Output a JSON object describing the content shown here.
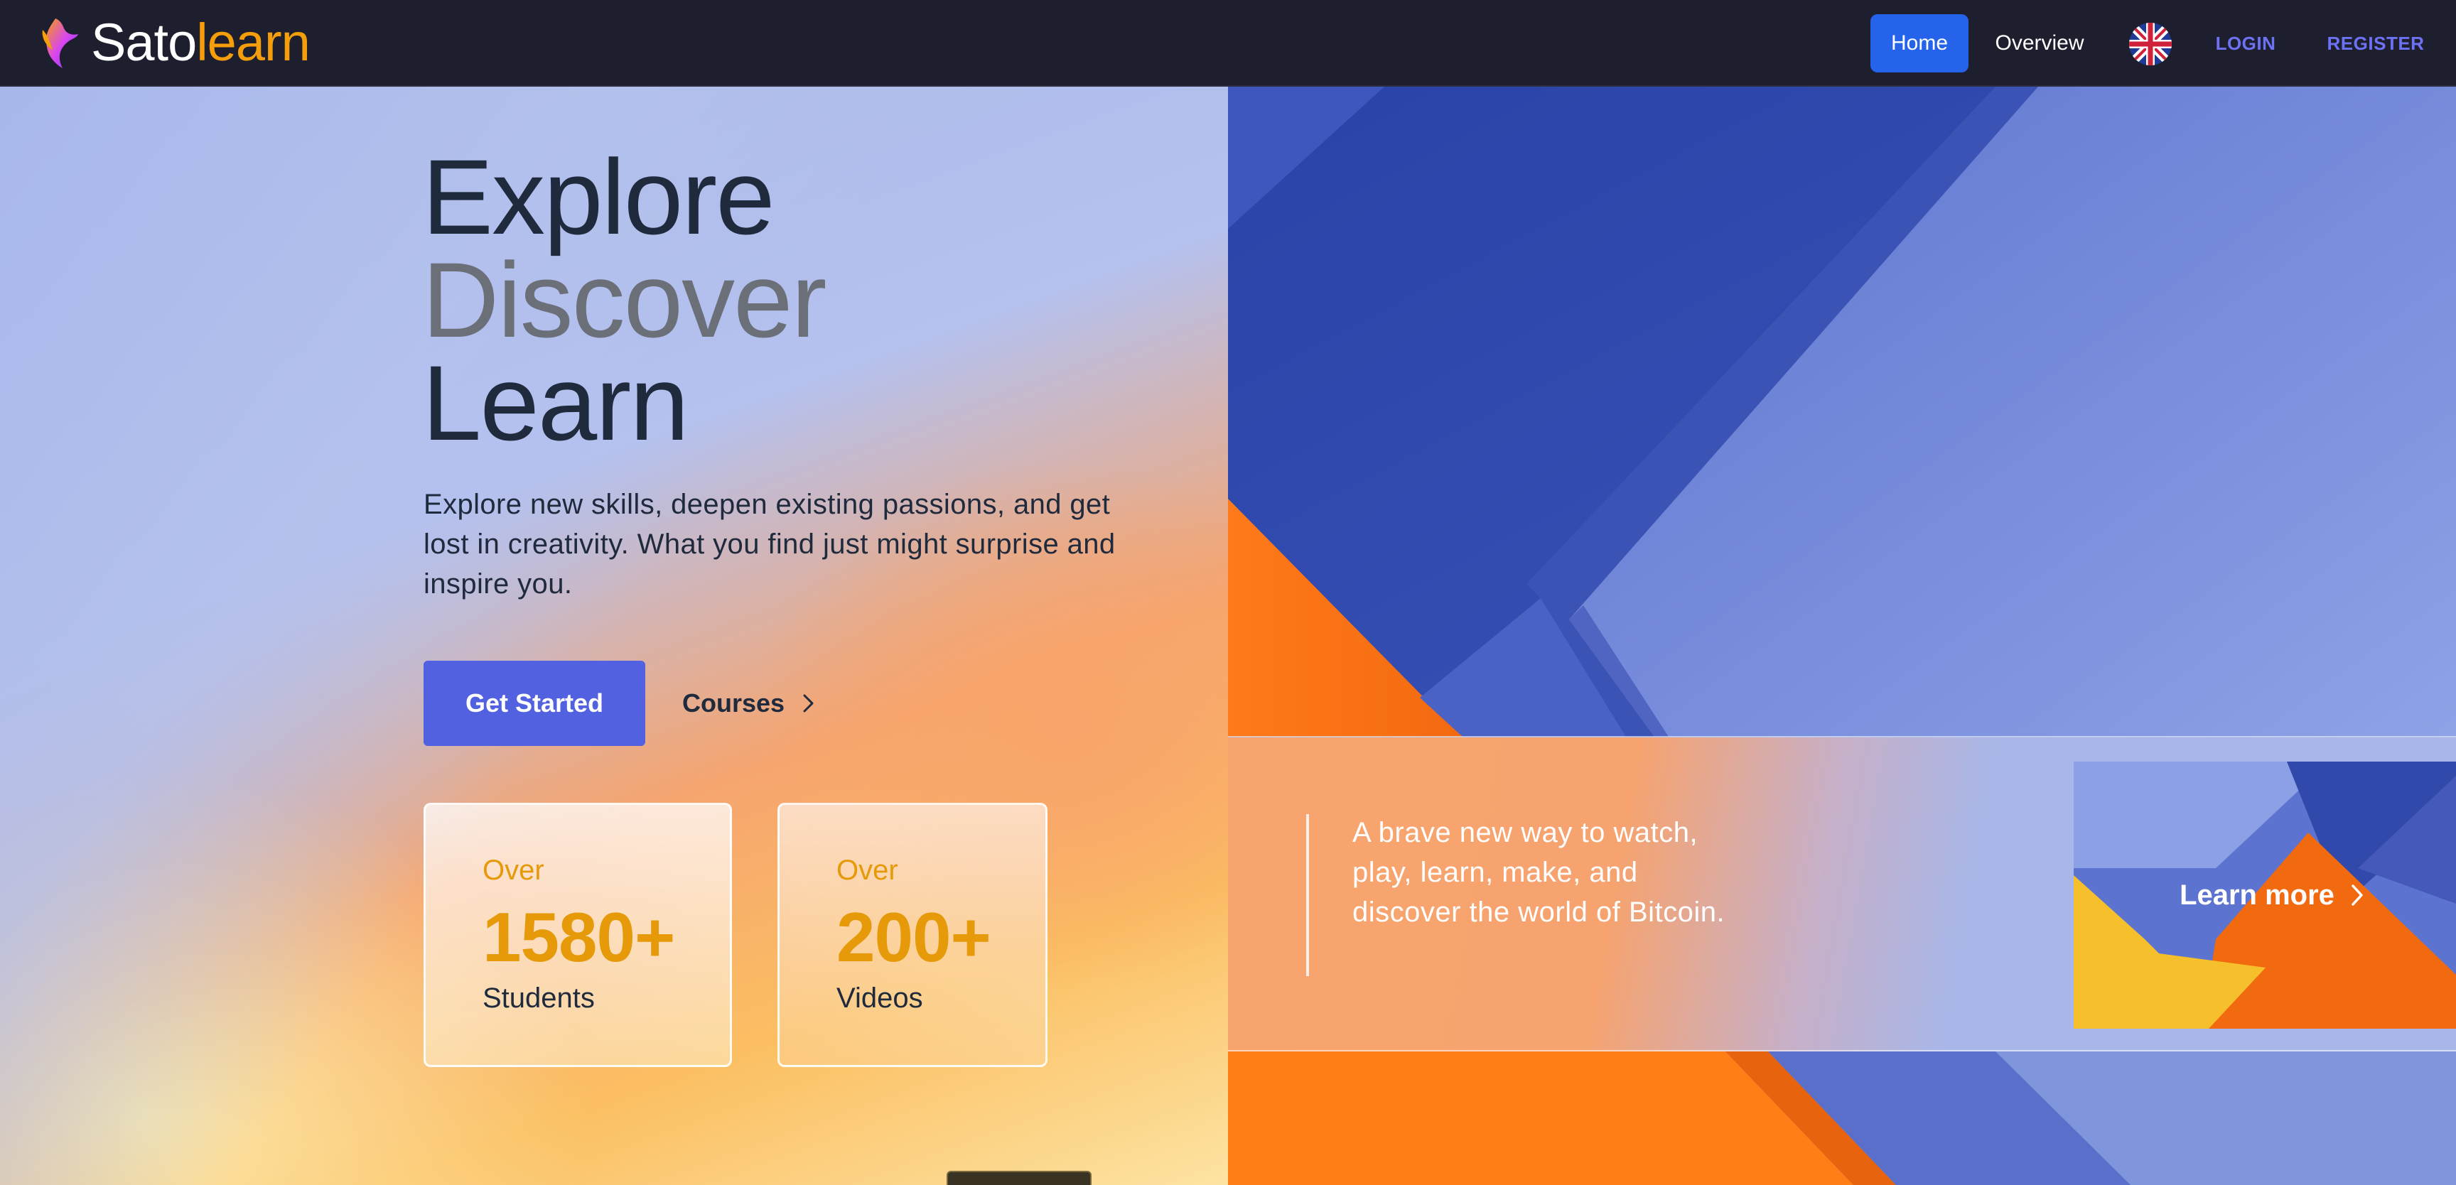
{
  "nav": {
    "logo_part1": "Sato",
    "logo_part2": "learn",
    "home": "Home",
    "overview": "Overview",
    "login": "LOGIN",
    "register": "REGISTER",
    "flag_icon": "uk-flag-icon"
  },
  "hero": {
    "line1": "Explore",
    "line2": "Discover",
    "line3": "Learn",
    "description": "Explore new skills, deepen existing passions, and get lost in creativity. What you find just might surprise and inspire you.",
    "cta_primary": "Get Started",
    "cta_secondary": "Courses",
    "stats": [
      {
        "prefix": "Over",
        "value": "1580+",
        "label": "Students"
      },
      {
        "prefix": "Over",
        "value": "200+",
        "label": "Videos"
      }
    ]
  },
  "promo": {
    "text": "A brave new way to watch, play, learn, make, and discover the world of Bitcoin.",
    "learn_more": "Learn more"
  },
  "colors": {
    "nav_bg": "#1e1f2e",
    "accent_blue": "#2563eb",
    "primary_button": "#5161e0",
    "logo_orange": "#f59e0b",
    "stat_orange": "#e69a0a",
    "auth_link": "#6d72f5"
  }
}
